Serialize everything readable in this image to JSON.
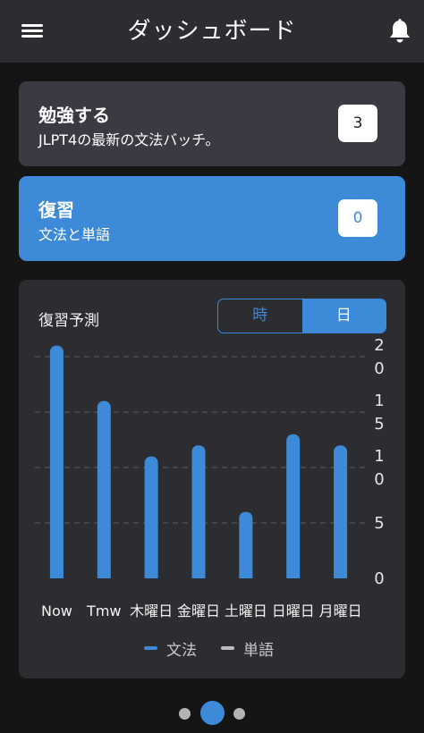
{
  "header": {
    "title": "ダッシュボード",
    "menu_icon": "hamburger-menu-icon",
    "bell_icon": "bell-icon"
  },
  "study_card": {
    "title": "勉強する",
    "subtitle": "JLPT4の最新の文法バッチ。",
    "count": "3"
  },
  "review_card": {
    "title": "復習",
    "subtitle": "文法と単語",
    "count": "0"
  },
  "forecast": {
    "title": "復習予測",
    "toggle": {
      "hour_label": "時",
      "day_label": "日",
      "selected": "day"
    },
    "legend": [
      {
        "name": "文法",
        "color": "#3d8ad9"
      },
      {
        "name": "単語",
        "color": "#bdbdbd"
      }
    ]
  },
  "colors": {
    "accent": "#3d8ad9",
    "card": "#3a3b42",
    "panel": "#2b2d30",
    "background": "#151515"
  },
  "pager": {
    "count": 3,
    "active": 1
  },
  "chart_data": {
    "type": "bar",
    "categories": [
      "Now",
      "Tmw",
      "木曜日",
      "金曜日",
      "土曜日",
      "日曜日",
      "月曜日"
    ],
    "series": [
      {
        "name": "文法",
        "values": [
          21,
          16,
          11,
          12,
          6,
          13,
          12
        ]
      }
    ],
    "ylim": [
      0,
      20
    ],
    "yticks": [
      "0",
      "5",
      "10",
      "15",
      "20"
    ],
    "grid": true,
    "legend_position": "bottom"
  }
}
